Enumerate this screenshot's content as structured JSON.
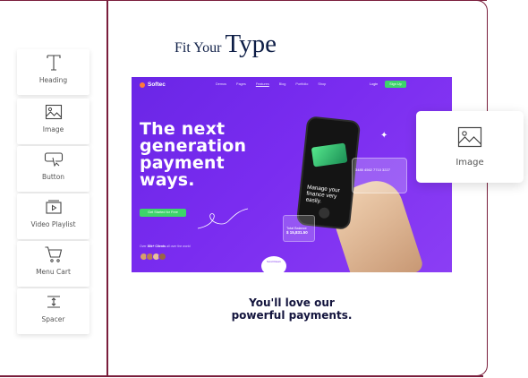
{
  "title": {
    "prefix": "Fit Your",
    "main": "Type"
  },
  "widgets": [
    {
      "label": "Heading",
      "icon": "heading-icon"
    },
    {
      "label": "Image",
      "icon": "image-icon"
    },
    {
      "label": "Button",
      "icon": "button-icon"
    },
    {
      "label": "Video Playlist",
      "icon": "video-playlist-icon"
    },
    {
      "label": "Menu Cart",
      "icon": "menu-cart-icon"
    },
    {
      "label": "Spacer",
      "icon": "spacer-icon"
    }
  ],
  "preview": {
    "logo": "Softec",
    "nav": [
      "Demos",
      "Pages",
      "Features",
      "Blog",
      "Portfolio",
      "Shop"
    ],
    "active_nav": "Features",
    "login": "Login",
    "signup": "Sign Up",
    "hero_lines": [
      "The next",
      "generation",
      "payment",
      "ways."
    ],
    "cta": "Get Started for Free",
    "users_prefix": "Over",
    "users_highlight": "30k+ Clients",
    "users_suffix": "all over the world",
    "phone_text": [
      "Manage your",
      "finance very",
      "easily."
    ],
    "card_number": "3485 4562 7710 3227",
    "balance_label": "Total Balance",
    "balance_value": "$ 15,831.50",
    "scroll_label": "Scroll Down"
  },
  "tagline": {
    "line1": "You'll love our",
    "line2": "powerful payments."
  },
  "floating_widget": {
    "label": "Image",
    "icon": "image-icon"
  },
  "colors": {
    "frame": "#7a1e3c",
    "hero_purple": "#7a2cf0",
    "accent_green": "#3dd46a",
    "title_navy": "#0f1f47"
  }
}
